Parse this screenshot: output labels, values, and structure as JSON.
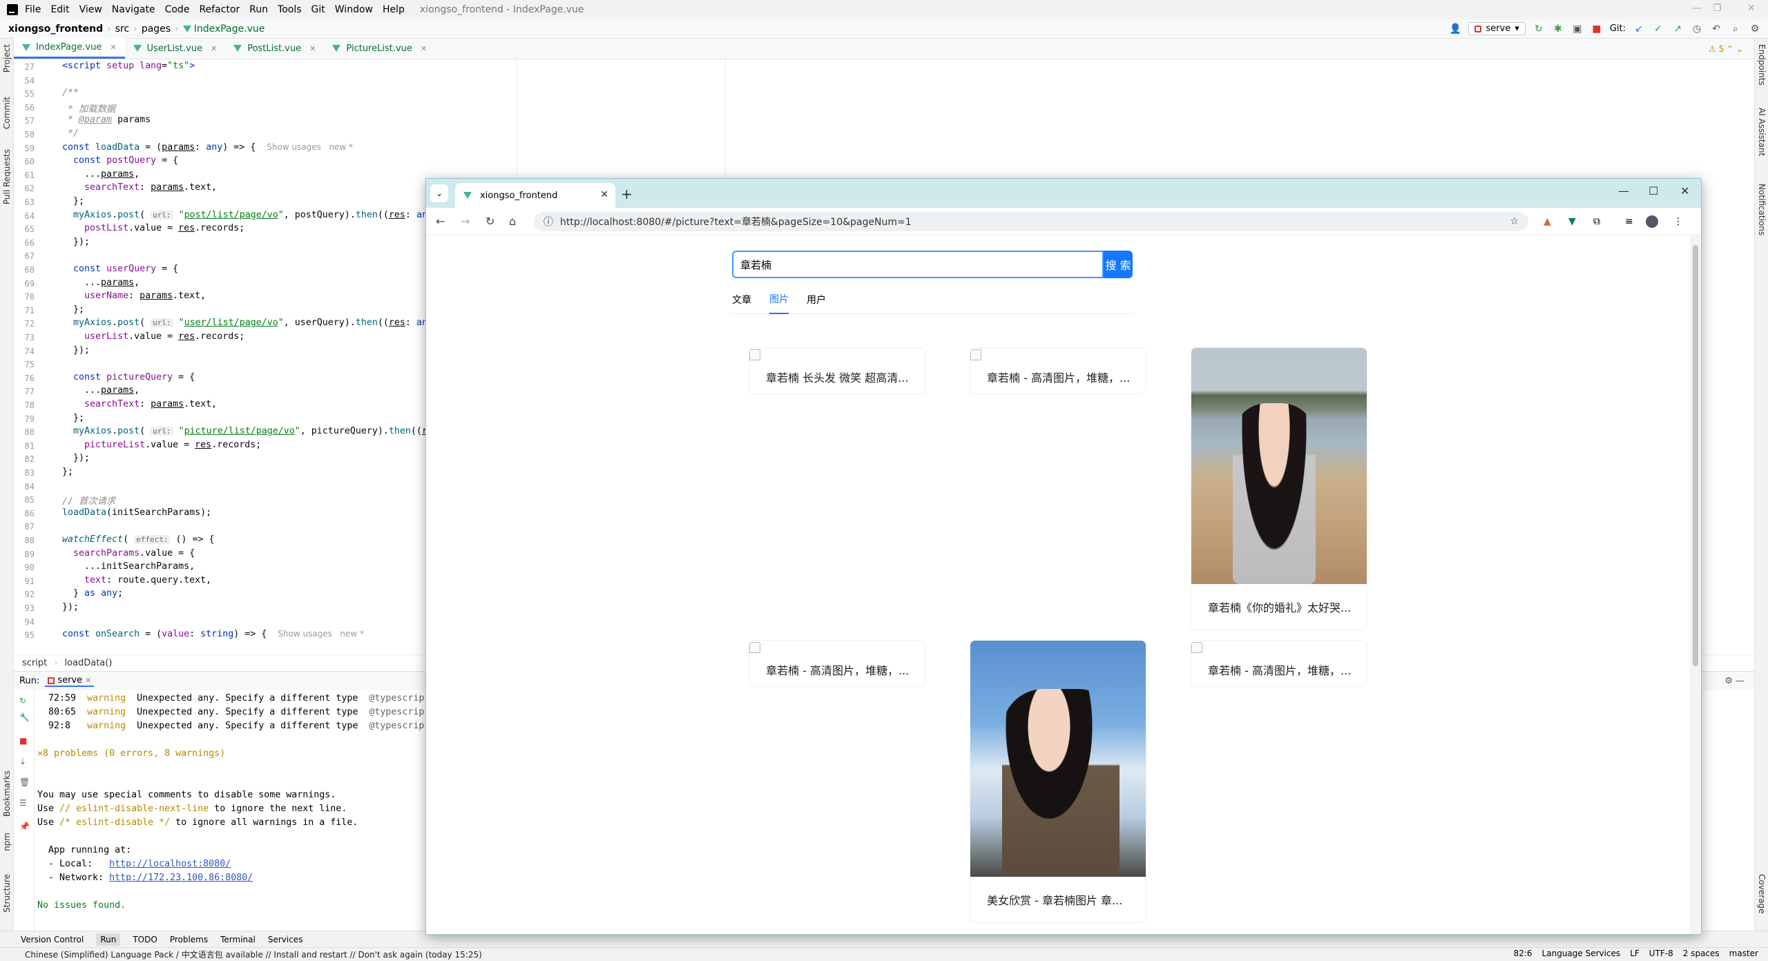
{
  "ide": {
    "menu": [
      "File",
      "Edit",
      "View",
      "Navigate",
      "Code",
      "Refactor",
      "Run",
      "Tools",
      "Git",
      "Window",
      "Help"
    ],
    "window_title": "xiongso_frontend - IndexPage.vue",
    "breadcrumb": [
      "xiongso_frontend",
      "src",
      "pages",
      "IndexPage.vue"
    ],
    "run_config": "serve",
    "git_label": "Git:",
    "tabs": [
      "IndexPage.vue",
      "UserList.vue",
      "PostList.vue",
      "PictureList.vue"
    ],
    "warnings_count": "5",
    "code_lines": [
      {
        "n": "27",
        "html": "<span class=\"tag\">&lt;script</span> <span class=\"prop\">setup</span> <span class=\"prop\">lang</span>=<span class=\"str\">\"ts\"</span><span class=\"tag\">&gt;</span>"
      },
      {
        "n": "54",
        "html": ""
      },
      {
        "n": "55",
        "html": "<span class=\"cmt\">/**</span>"
      },
      {
        "n": "56",
        "html": "<span class=\"cmt\"> * 加载数据</span>"
      },
      {
        "n": "57",
        "html": "<span class=\"cmt\"> * <u>@param</u></span> <span>params</span>"
      },
      {
        "n": "58",
        "html": "<span class=\"cmt\"> */</span>"
      },
      {
        "n": "59",
        "html": "<span class=\"kw\">const</span> <span class=\"fn\">loadData</span> = (<u>params</u>: <span class=\"kw\">any</span>) =&gt; {  <span class=\"dim\">Show usages   new *</span>"
      },
      {
        "n": "60",
        "html": "  <span class=\"kw\">const</span> <span class=\"prop\">postQuery</span> = {"
      },
      {
        "n": "61",
        "html": "    ...<u>params</u>,"
      },
      {
        "n": "62",
        "html": "    <span class=\"prop\">searchText</span>: <u>params</u>.text,"
      },
      {
        "n": "63",
        "html": "  };"
      },
      {
        "n": "64",
        "html": "  <span class=\"fn\">myAxios</span>.<span class=\"fn\">post</span>( <span class=\"hint\">url:</span> <span class=\"str\">\"<u>post/list/page/vo</u>\"</span>, postQuery).<span class=\"fn\">then</span>((<u>res</u>: <span class=\"kw\">any</span>)"
      },
      {
        "n": "65",
        "html": "    <span class=\"prop\">postList</span>.value = <u>res</u>.records;"
      },
      {
        "n": "66",
        "html": "  });"
      },
      {
        "n": "67",
        "html": ""
      },
      {
        "n": "68",
        "html": "  <span class=\"kw\">const</span> <span class=\"prop\">userQuery</span> = {"
      },
      {
        "n": "69",
        "html": "    ...<u>params</u>,"
      },
      {
        "n": "70",
        "html": "    <span class=\"prop\">userName</span>: <u>params</u>.text,"
      },
      {
        "n": "71",
        "html": "  };"
      },
      {
        "n": "72",
        "html": "  <span class=\"fn\">myAxios</span>.<span class=\"fn\">post</span>( <span class=\"hint\">url:</span> <span class=\"str\">\"<u>user/list/page/vo</u>\"</span>, userQuery).<span class=\"fn\">then</span>((<u>res</u>: <span class=\"kw\">any</span>)"
      },
      {
        "n": "73",
        "html": "    <span class=\"prop\">userList</span>.value = <u>res</u>.records;"
      },
      {
        "n": "74",
        "html": "  });"
      },
      {
        "n": "75",
        "html": ""
      },
      {
        "n": "76",
        "html": "  <span class=\"kw\">const</span> <span class=\"prop\">pictureQuery</span> = {"
      },
      {
        "n": "77",
        "html": "    ...<u>params</u>,"
      },
      {
        "n": "78",
        "html": "    <span class=\"prop\">searchText</span>: <u>params</u>.text,"
      },
      {
        "n": "79",
        "html": "  };"
      },
      {
        "n": "80",
        "html": "  <span class=\"fn\">myAxios</span>.<span class=\"fn\">post</span>( <span class=\"hint\">url:</span> <span class=\"str\">\"<u>picture/list/page/vo</u>\"</span>, pictureQuery).<span class=\"fn\">then</span>((<u>res</u>"
      },
      {
        "n": "81",
        "html": "    <span class=\"prop\">pictureList</span>.value = <u>res</u>.records;"
      },
      {
        "n": "82",
        "html": "  });"
      },
      {
        "n": "83",
        "html": "};"
      },
      {
        "n": "84",
        "html": ""
      },
      {
        "n": "85",
        "html": "<span class=\"cmt\">// 首次请求</span>"
      },
      {
        "n": "86",
        "html": "<span class=\"fn\">loadData</span>(initSearchParams);"
      },
      {
        "n": "87",
        "html": ""
      },
      {
        "n": "88",
        "html": "<i class=\"fn\">watchEffect</i>( <span class=\"hint\">effect:</span> () =&gt; {"
      },
      {
        "n": "89",
        "html": "  <span class=\"prop\">searchParams</span>.value = {"
      },
      {
        "n": "90",
        "html": "    ...initSearchParams,"
      },
      {
        "n": "91",
        "html": "    <span class=\"prop\">text</span>: route.query.text,"
      },
      {
        "n": "92",
        "html": "  } <span class=\"kw\">as</span> <span class=\"kw\">any</span>;"
      },
      {
        "n": "93",
        "html": "});"
      },
      {
        "n": "94",
        "html": ""
      },
      {
        "n": "95",
        "html": "<span class=\"kw\">const</span> <span class=\"fn\">onSearch</span> = (<span class=\"prop\">value</span>: <span class=\"kw\">string</span>) =&gt; {  <span class=\"dim\">Show usages   new *</span>"
      }
    ],
    "editor_crumb": [
      "script",
      "loadData()"
    ],
    "run_label": "Run:",
    "run_tab": "serve",
    "console_lines": [
      {
        "html": "  72:59  <span class=\"warn\">warning</span>  Unexpected any. Specify a different type  <span style=\"color:#666\">@typescrip</span>"
      },
      {
        "html": "  80:65  <span class=\"warn\">warning</span>  Unexpected any. Specify a different type  <span style=\"color:#666\">@typescrip</span>"
      },
      {
        "html": "  92:8   <span class=\"warn\">warning</span>  Unexpected any. Specify a different type  <span style=\"color:#666\">@typescrip</span>"
      },
      {
        "html": ""
      },
      {
        "html": "<span class=\"warn\">✕8 problems (0 errors, 8 warnings)</span>"
      },
      {
        "html": ""
      },
      {
        "html": ""
      },
      {
        "html": "You may use special comments to disable some warnings."
      },
      {
        "html": "Use <span class=\"warn\">// eslint-disable-next-line</span> to ignore the next line."
      },
      {
        "html": "Use <span class=\"warn\">/* eslint-disable */</span> to ignore all warnings in a file."
      },
      {
        "html": ""
      },
      {
        "html": "  App running at:"
      },
      {
        "html": "  - Local:   <span class=\"link\">http://localhost:8080/</span>"
      },
      {
        "html": "  - Network: <span class=\"link\">http://172.23.100.86:8080/</span>"
      },
      {
        "html": ""
      },
      {
        "html": "<span class=\"ok\">No issues found.</span>"
      }
    ],
    "bottom_tabs": [
      "Version Control",
      "Run",
      "TODO",
      "Problems",
      "Terminal",
      "Services"
    ],
    "status_message": "Chinese (Simplified) Language Pack / 中文语言包 available // Install and restart // Don't ask again (today 15:25)",
    "status_right": [
      "82:6",
      "Language Services",
      "LF",
      "UTF-8",
      "2 spaces",
      "master"
    ],
    "left_strip": [
      "Project",
      "Commit",
      "Pull Requests",
      "Bookmarks",
      "npm",
      "Structure"
    ],
    "right_strip": [
      "Endpoints",
      "AI Assistant",
      "Notifications",
      "Coverage"
    ]
  },
  "browser": {
    "tab_title": "xiongso_frontend",
    "url": "http://localhost:8080/#/picture?text=章若楠&pageSize=10&pageNum=1",
    "search_value": "章若楠",
    "search_button": "搜 索",
    "tabs": [
      "文章",
      "图片",
      "用户"
    ],
    "active_tab": "图片",
    "cards": [
      {
        "caption": "章若楠 长头发 微笑 超高清..."
      },
      {
        "caption": "章若楠 - 高清图片，堆糖，..."
      },
      {
        "caption": "章若楠《你的婚礼》太好哭..."
      },
      {
        "caption": "章若楠 - 高清图片，堆糖，..."
      },
      {
        "caption": "美女欣赏 - 章若楠图片 章..."
      },
      {
        "caption": "章若楠 - 高清图片，堆糖，..."
      }
    ]
  }
}
